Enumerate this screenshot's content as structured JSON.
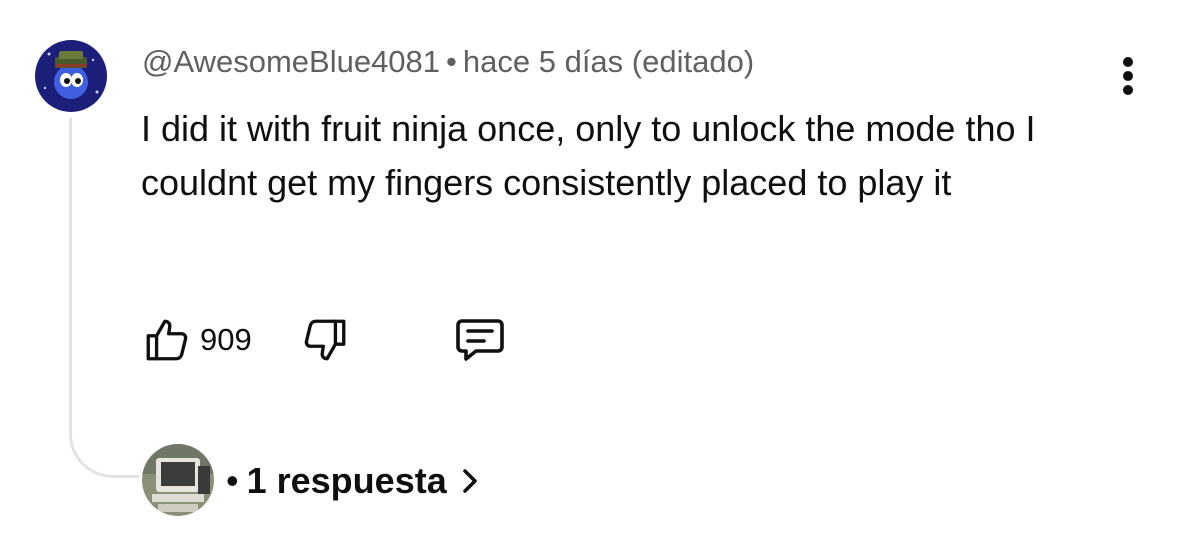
{
  "comment": {
    "author": "@AwesomeBlue4081",
    "separator": "•",
    "timestamp": "hace 5 días (editado)",
    "text": "I did it with fruit ninja once, only to unlock the mode tho I couldnt get my fingers consistently placed to play it",
    "likes": "909",
    "icons": {
      "avatar": "blue-creature-avatar",
      "more": "more-vert-icon",
      "like": "thumb-up-icon",
      "dislike": "thumb-down-icon",
      "reply": "comment-reply-icon"
    }
  },
  "replies": {
    "separator": "•",
    "label": "1 respuesta",
    "icons": {
      "avatar": "computer-avatar",
      "chevron": "chevron-right-icon"
    }
  },
  "colors": {
    "text": "#0f0f0f",
    "meta": "#606060",
    "thread_line": "#e2e2e2"
  }
}
